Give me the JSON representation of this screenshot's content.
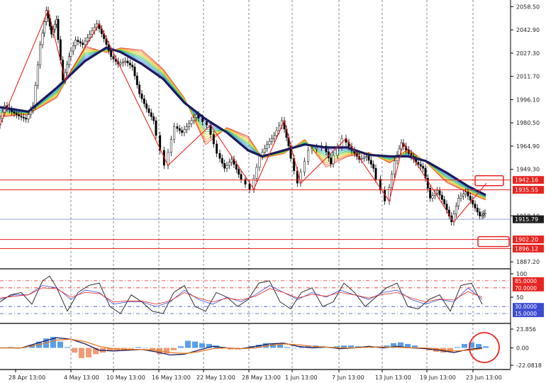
{
  "chart_data": [
    {
      "panel": "price",
      "type": "line",
      "y_axis_ticks": [
        "2058.50",
        "2042.90",
        "2027.30",
        "2011.70",
        "1996.10",
        "1980.50",
        "1964.90",
        "1949.30",
        "1918.10",
        "1887.20"
      ],
      "ylim": [
        1887.2,
        2058.5
      ],
      "x_axis_ticks": [
        "28 Apr 13:00",
        "4 May 13:00",
        "10 May 13:00",
        "16 May 13:00",
        "22 May 13:00",
        "28 May 13:00",
        "1 Jun 13:00",
        "7 Jun 13:00",
        "13 Jun 13:00",
        "19 Jun 13:00",
        "23 Jun 13:00"
      ],
      "current_price": {
        "value": 1915.79,
        "label": "1915.79",
        "color": "#1e3f8f"
      },
      "horizontal_levels": [
        {
          "value": 1942.16,
          "label": "1942.16",
          "color": "#e8231f"
        },
        {
          "value": 1935.55,
          "label": "1935.55",
          "color": "#e8231f"
        },
        {
          "value": 1902.2,
          "label": "1902.20",
          "color": "#e8231f"
        },
        {
          "value": 1896.12,
          "label": "1896.12",
          "color": "#e8231f"
        }
      ],
      "moving_average": {
        "color": "#1a1a5e",
        "x": [
          0,
          40,
          80,
          120,
          150,
          170,
          200,
          230,
          260,
          290,
          320,
          350,
          370,
          400,
          430,
          460,
          490,
          520,
          550,
          575,
          600,
          630,
          660,
          685
        ],
        "y": [
          1991,
          1988,
          2004,
          2022,
          2031,
          2028,
          2020,
          2010,
          1994,
          1983,
          1974,
          1962,
          1958,
          1962,
          1966,
          1964,
          1964,
          1959,
          1958,
          1958,
          1955,
          1947,
          1938,
          1932
        ]
      },
      "zigzag": {
        "color": "#e8231f",
        "x": [
          0,
          68,
          92,
          140,
          237,
          297,
          358,
          401,
          424,
          488,
          549,
          569,
          640,
          686
        ],
        "y": [
          1979,
          2056,
          2009,
          2047,
          1952,
          1979,
          1936,
          1982,
          1940,
          1970,
          1928,
          1967,
          1914,
          1940
        ]
      },
      "price_path": {
        "color": "#000000",
        "x": [
          0,
          10,
          20,
          30,
          40,
          50,
          60,
          68,
          75,
          82,
          92,
          100,
          110,
          120,
          130,
          140,
          150,
          160,
          170,
          180,
          190,
          200,
          210,
          220,
          237,
          250,
          260,
          270,
          280,
          297,
          310,
          320,
          330,
          340,
          358,
          370,
          380,
          390,
          401,
          410,
          424,
          440,
          460,
          470,
          488,
          500,
          510,
          520,
          530,
          549,
          560,
          569,
          580,
          590,
          600,
          610,
          620,
          630,
          640,
          650,
          660,
          670,
          680,
          686
        ],
        "y": [
          1979,
          1992,
          1988,
          1985,
          1983,
          1992,
          2033,
          2056,
          2040,
          2050,
          2009,
          2025,
          2036,
          2033,
          2040,
          2047,
          2037,
          2025,
          2020,
          2022,
          2018,
          2000,
          1990,
          1982,
          1952,
          1978,
          1974,
          1980,
          1986,
          1979,
          1960,
          1950,
          1956,
          1946,
          1936,
          1958,
          1966,
          1972,
          1982,
          1965,
          1940,
          1962,
          1965,
          1953,
          1970,
          1962,
          1956,
          1958,
          1950,
          1928,
          1955,
          1967,
          1960,
          1954,
          1950,
          1930,
          1935,
          1926,
          1914,
          1930,
          1934,
          1926,
          1918,
          1920
        ]
      }
    },
    {
      "panel": "oscillator",
      "type": "line",
      "y_axis_ticks": [
        "100",
        "50"
      ],
      "ylim": [
        0,
        100
      ],
      "levels": [
        {
          "value": 85,
          "label": "85.0000",
          "color": "#e8231f"
        },
        {
          "value": 70,
          "label": "70.0000",
          "color": "#e8231f"
        },
        {
          "value": 30,
          "label": "30.0000",
          "color": "#3a4bd0"
        },
        {
          "value": 15,
          "label": "15.0000",
          "color": "#3a4bd0"
        }
      ],
      "series": [
        {
          "color": "#1a1a1a",
          "x": [
            0,
            15,
            30,
            45,
            60,
            70,
            80,
            95,
            110,
            125,
            140,
            155,
            170,
            185,
            200,
            215,
            230,
            245,
            260,
            275,
            290,
            305,
            320,
            335,
            350,
            365,
            380,
            395,
            410,
            425,
            440,
            455,
            470,
            485,
            500,
            515,
            530,
            545,
            560,
            575,
            590,
            605,
            620,
            635,
            650,
            665,
            680
          ],
          "y": [
            40,
            55,
            60,
            35,
            85,
            95,
            70,
            20,
            60,
            75,
            80,
            30,
            15,
            55,
            40,
            20,
            15,
            60,
            75,
            30,
            20,
            60,
            50,
            30,
            45,
            80,
            85,
            40,
            25,
            60,
            70,
            30,
            40,
            80,
            60,
            30,
            50,
            70,
            80,
            30,
            25,
            45,
            55,
            20,
            75,
            80,
            35
          ]
        },
        {
          "color": "#3a4bd0",
          "x": [
            0,
            20,
            40,
            60,
            80,
            100,
            120,
            140,
            160,
            180,
            200,
            220,
            240,
            260,
            280,
            300,
            320,
            340,
            360,
            380,
            400,
            420,
            440,
            460,
            480,
            500,
            520,
            540,
            560,
            580,
            600,
            620,
            640,
            660,
            680
          ],
          "y": [
            45,
            55,
            55,
            75,
            70,
            45,
            65,
            60,
            35,
            40,
            40,
            30,
            40,
            65,
            45,
            35,
            50,
            40,
            55,
            75,
            60,
            45,
            60,
            50,
            65,
            55,
            45,
            60,
            65,
            45,
            35,
            45,
            40,
            70,
            45
          ]
        },
        {
          "color": "#e8231f",
          "x": [
            0,
            20,
            40,
            60,
            80,
            100,
            120,
            140,
            160,
            180,
            200,
            220,
            240,
            260,
            280,
            300,
            320,
            340,
            360,
            380,
            400,
            420,
            440,
            460,
            480,
            500,
            520,
            540,
            560,
            580,
            600,
            620,
            640,
            660,
            680
          ],
          "y": [
            48,
            52,
            55,
            70,
            68,
            50,
            60,
            58,
            40,
            42,
            42,
            35,
            42,
            60,
            48,
            40,
            48,
            44,
            52,
            68,
            60,
            48,
            56,
            52,
            60,
            55,
            48,
            56,
            60,
            48,
            40,
            46,
            44,
            62,
            50
          ]
        }
      ]
    },
    {
      "panel": "macd",
      "type": "bar",
      "y_axis_ticks": [
        "23.856",
        "0.00",
        "-22.0818"
      ],
      "ylim": [
        -22.0818,
        23.856
      ],
      "histogram": {
        "positive_color": "#3c8ee8",
        "negative_color": "#f0885a",
        "x": [
          5,
          15,
          25,
          35,
          45,
          55,
          65,
          75,
          85,
          95,
          105,
          115,
          125,
          135,
          145,
          155,
          165,
          175,
          185,
          195,
          205,
          215,
          225,
          235,
          245,
          255,
          265,
          275,
          285,
          295,
          305,
          315,
          325,
          335,
          345,
          355,
          365,
          375,
          385,
          395,
          405,
          415,
          425,
          435,
          445,
          455,
          465,
          475,
          485,
          495,
          505,
          515,
          525,
          535,
          545,
          555,
          565,
          575,
          585,
          595,
          605,
          615,
          625,
          635,
          645,
          655,
          665,
          675,
          685
        ],
        "values": [
          0,
          1,
          -1,
          0,
          4,
          8,
          12,
          14,
          8,
          1,
          -6,
          -13,
          -12,
          -8,
          -6,
          -4,
          -4,
          -3,
          -1,
          1,
          0,
          -3,
          -8,
          -7,
          -3,
          2,
          9,
          8,
          6,
          5,
          3,
          1,
          -2,
          -2,
          0,
          2,
          4,
          6,
          5,
          4,
          1,
          0,
          1,
          3,
          3,
          2,
          1,
          2,
          3,
          3,
          2,
          1,
          1,
          2,
          3,
          6,
          7,
          5,
          3,
          -1,
          -3,
          -5,
          -6,
          -5,
          1,
          5,
          7,
          5,
          2
        ]
      },
      "series": [
        {
          "color": "#1a1a5e",
          "x": [
            0,
            30,
            60,
            80,
            100,
            120,
            140,
            160,
            180,
            200,
            220,
            240,
            260,
            280,
            300,
            320,
            340,
            360,
            380,
            400,
            420,
            440,
            460,
            480,
            500,
            520,
            540,
            560,
            580,
            600,
            620,
            640,
            660,
            680
          ],
          "y": [
            0,
            0,
            8,
            13,
            11,
            5,
            -3,
            -4,
            -3,
            -2,
            -5,
            -9,
            -8,
            -3,
            2,
            0,
            -1,
            2,
            5,
            6,
            2,
            0,
            1,
            -1,
            0,
            2,
            0,
            2,
            0,
            -1,
            -3,
            -6,
            -2,
            0
          ]
        },
        {
          "color": "#e8781e",
          "x": [
            0,
            30,
            60,
            80,
            100,
            120,
            140,
            160,
            180,
            200,
            220,
            240,
            260,
            280,
            300,
            320,
            340,
            360,
            380,
            400,
            420,
            440,
            460,
            480,
            500,
            520,
            540,
            560,
            580,
            600,
            620,
            640,
            660,
            680
          ],
          "y": [
            0,
            0,
            5,
            10,
            11,
            8,
            2,
            -1,
            -2,
            -2,
            -3,
            -6,
            -7,
            -5,
            -1,
            0,
            -1,
            0,
            3,
            5,
            4,
            2,
            1,
            0,
            0,
            1,
            1,
            1,
            0,
            0,
            -2,
            -4,
            -3,
            -1
          ]
        }
      ],
      "annotation": {
        "type": "circle",
        "color": "#e8231f"
      }
    }
  ]
}
